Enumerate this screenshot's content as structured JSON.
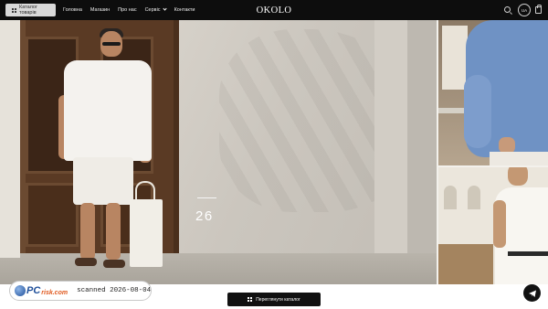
{
  "header": {
    "catalog_button": "Каталог товарів",
    "nav": [
      {
        "label": "Головна"
      },
      {
        "label": "Магазин"
      },
      {
        "label": "Про нас"
      },
      {
        "label": "Сервіс"
      },
      {
        "label": "Контакти"
      }
    ],
    "logo": "OKOLO",
    "language": "UA",
    "icons": [
      "search-icon",
      "shopping-bag-icon"
    ]
  },
  "hero": {
    "slide_number": "26"
  },
  "bottom": {
    "catalog_button": "Переглянути каталог",
    "badge_brand_pc": "PC",
    "badge_brand_risk": "risk.com",
    "badge_text": "scanned 2026-08-04",
    "telegram_icon": "telegram-icon"
  },
  "colors": {
    "header_bg": "#0d0d0d",
    "accent_dark": "#111111",
    "background": "#f3f1ec"
  }
}
